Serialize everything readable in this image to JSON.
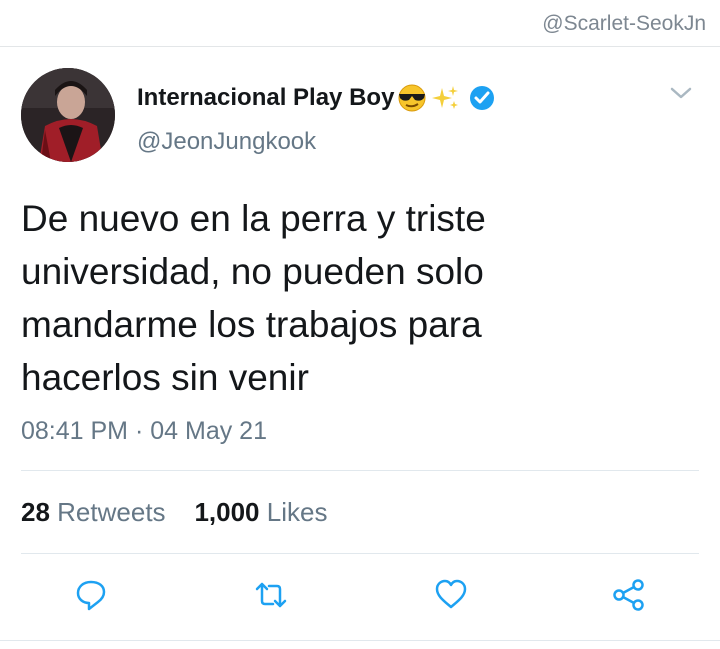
{
  "watermark": "@Scarlet-SeokJn",
  "tweet": {
    "display_name": "Internacional Play Boy",
    "handle": "@JeonJungkook",
    "verified": true,
    "text_lines": [
      "De nuevo en la perra y triste",
      "universidad, no pueden solo",
      "mandarme los trabajos para",
      "hacerlos sin venir"
    ],
    "time": "08:41 PM",
    "separator": "·",
    "date": "04 May 21",
    "retweets_count": "28",
    "retweets_label": "Retweets",
    "likes_count": "1,000",
    "likes_label": "Likes"
  },
  "icons": {
    "name_emojis": [
      "sunglasses-emoji",
      "sparkles-emoji",
      "verified-badge-icon"
    ],
    "menu": "chevron-down-icon",
    "actions": [
      "reply-icon",
      "retweet-icon",
      "like-icon",
      "share-icon"
    ]
  },
  "colors": {
    "text": "#14171a",
    "secondary": "#657786",
    "icon": "#1da1f2",
    "verified": "#1da1f2",
    "divider": "#e1e8ed"
  }
}
